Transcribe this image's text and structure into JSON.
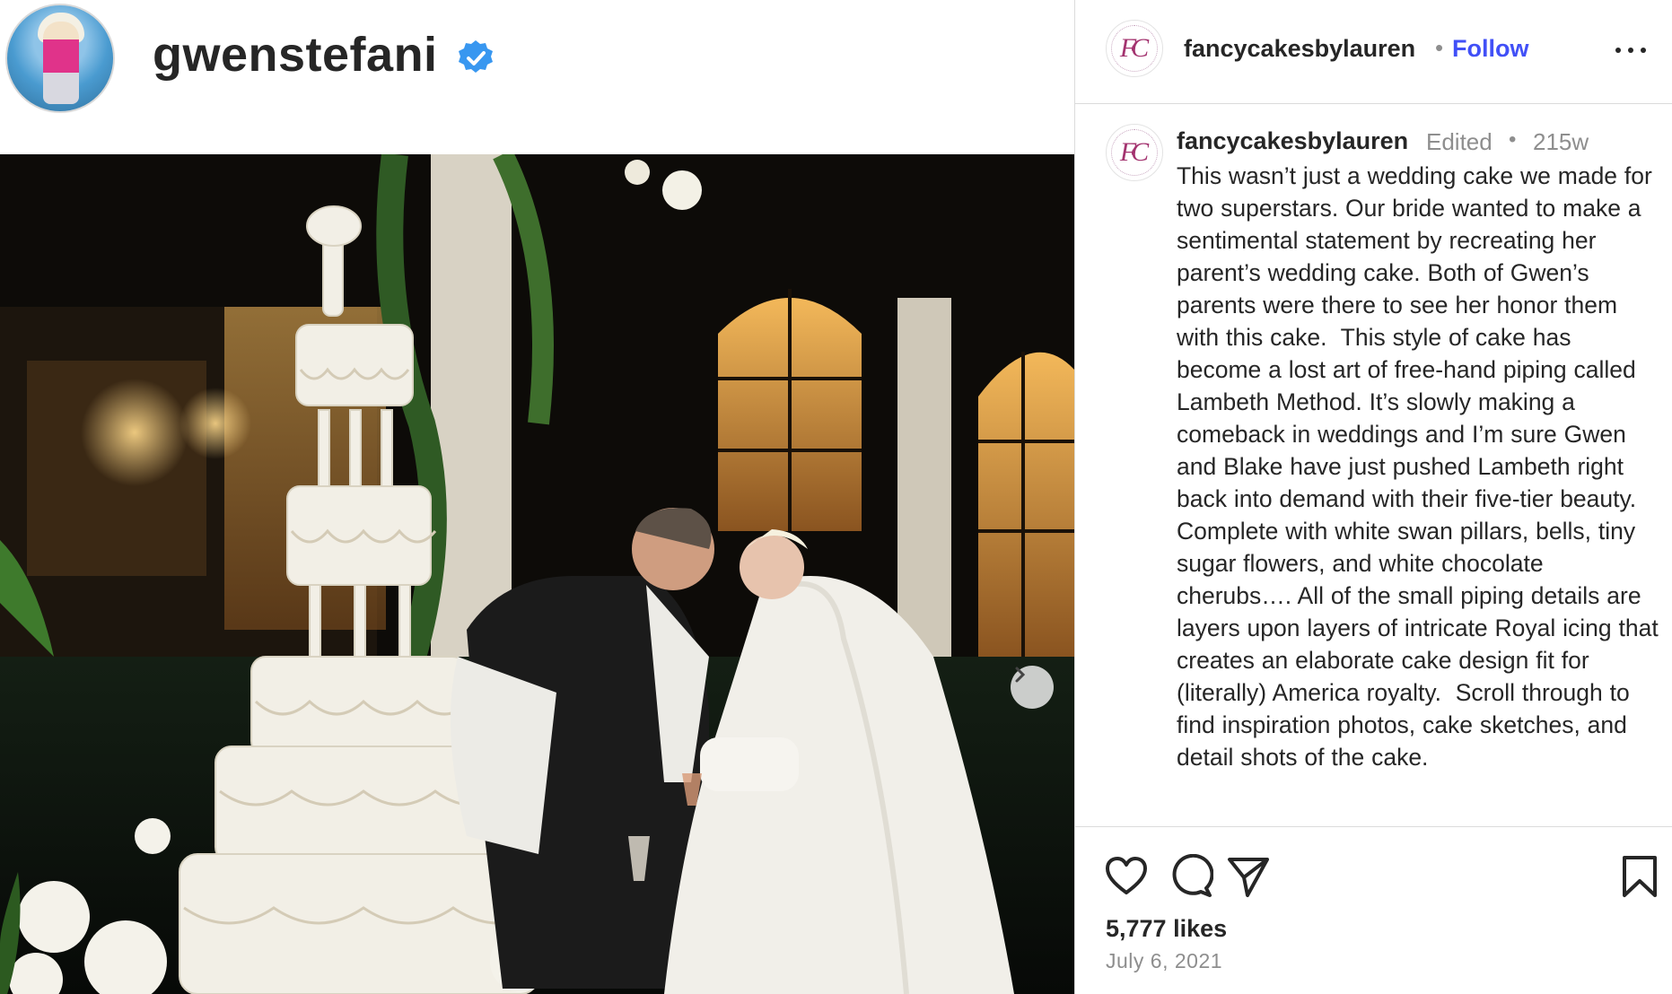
{
  "author": {
    "username": "gwenstefani",
    "verified": true,
    "avatar_icon": "profile-avatar",
    "badge_icon": "verified-badge-icon"
  },
  "photo": {
    "has_next": true,
    "next_icon": "chevron-right-icon"
  },
  "post_header": {
    "username": "fancycakesbylauren",
    "separator": "•",
    "follow_label": "Follow",
    "more_icon": "more-options-icon",
    "avatar_monogram": "FC"
  },
  "caption": {
    "username": "fancycakesbylauren",
    "edited_label": "Edited",
    "separator": "•",
    "time_ago": "215w",
    "avatar_monogram": "FC",
    "text": "This wasn’t just a wedding cake we made for two superstars. Our bride wanted to make a sentimental statement by recreating her parent’s wedding cake. Both of Gwen’s parents were there to see her honor them with this cake.  This style of cake has become a lost art of free-hand piping called Lambeth Method. It’s slowly making a comeback in weddings and I’m sure Gwen and Blake have just pushed Lambeth right back into demand with their five-tier beauty. Complete with white swan pillars, bells, tiny sugar flowers, and white chocolate cherubs…. All of the small piping details are layers upon layers of intricate Royal icing that creates an elaborate cake design fit for (literally) America royalty.  Scroll through to find inspiration photos, cake sketches, and detail shots of the cake."
  },
  "actions": {
    "like_icon": "heart-icon",
    "comment_icon": "comment-icon",
    "share_icon": "share-icon",
    "save_icon": "bookmark-icon",
    "likes_text": "5,777 likes",
    "date": "July 6, 2021"
  },
  "colors": {
    "follow_blue": "#4150f7",
    "verified_blue": "#3897f0",
    "muted_gray": "#8e8e8e",
    "monogram_magenta": "#a3336f"
  }
}
